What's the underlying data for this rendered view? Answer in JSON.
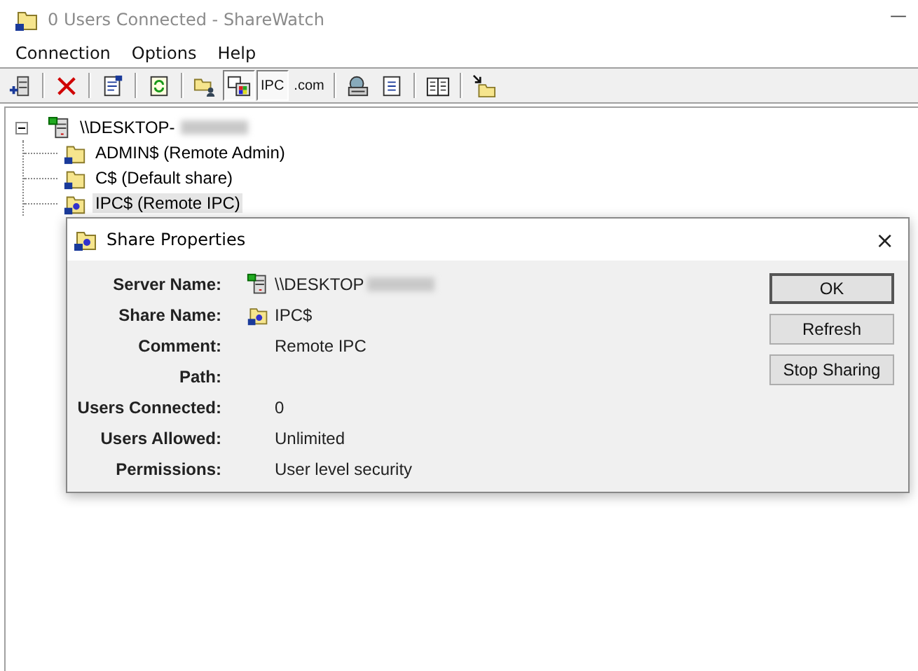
{
  "window": {
    "title": "0 Users Connected - ShareWatch",
    "minimize": "—"
  },
  "menu": [
    {
      "label": "Connection"
    },
    {
      "label": "Options"
    },
    {
      "label": "Help"
    }
  ],
  "toolbar": [
    {
      "kind": "icon",
      "pressed": false
    },
    {
      "kind": "sep"
    },
    {
      "kind": "icon",
      "pressed": false
    },
    {
      "kind": "sep"
    },
    {
      "kind": "icon",
      "pressed": false
    },
    {
      "kind": "sep"
    },
    {
      "kind": "icon",
      "pressed": false
    },
    {
      "kind": "sep"
    },
    {
      "kind": "icon",
      "pressed": false
    },
    {
      "kind": "icon",
      "pressed": true
    },
    {
      "kind": "text",
      "label": "IPC",
      "pressed": true
    },
    {
      "kind": "text",
      "label": ".com",
      "pressed": false
    },
    {
      "kind": "sep"
    },
    {
      "kind": "icon",
      "pressed": false
    },
    {
      "kind": "icon",
      "pressed": false
    },
    {
      "kind": "sep"
    },
    {
      "kind": "icon",
      "pressed": false
    },
    {
      "kind": "sep"
    },
    {
      "kind": "icon",
      "pressed": false
    }
  ],
  "tree": [
    {
      "label": "\\\\DESKTOP-",
      "kind": "server",
      "blurred": true,
      "expanded": true,
      "selected": false,
      "children": [
        {
          "label": "ADMIN$ (Remote Admin)",
          "kind": "share",
          "selected": false
        },
        {
          "label": "C$ (Default share)",
          "kind": "share",
          "selected": false
        },
        {
          "label": "IPC$ (Remote IPC)",
          "kind": "ipc",
          "selected": true
        }
      ]
    }
  ],
  "dialog": {
    "title": "Share Properties",
    "close": "×",
    "fields": [
      {
        "label": "Server Name:",
        "value": "\\\\DESKTOP",
        "blurred": true
      },
      {
        "label": "Share Name:",
        "value": "IPC$"
      },
      {
        "label": "Comment:",
        "value": "Remote IPC"
      },
      {
        "label": "Path:"
      },
      {
        "label": "Users Connected:",
        "value": "0"
      },
      {
        "label": "Users Allowed:",
        "value": "Unlimited"
      },
      {
        "label": "Permissions:",
        "value": "User level security"
      }
    ],
    "buttons": [
      {
        "label": "OK",
        "default": true
      },
      {
        "label": "Refresh",
        "default": false
      },
      {
        "label": "Stop Sharing",
        "default": false
      }
    ]
  }
}
